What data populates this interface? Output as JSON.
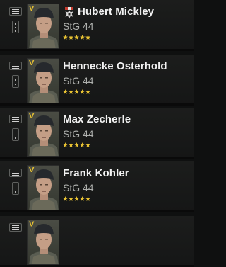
{
  "soldiers": [
    {
      "name": "Hubert Mickley",
      "weapon": "StG 44",
      "rank": "V",
      "stars": 5,
      "has_medal": true,
      "dots": 3
    },
    {
      "name": "Hennecke Osterhold",
      "weapon": "StG 44",
      "rank": "V",
      "stars": 5,
      "has_medal": false,
      "dots": 2
    },
    {
      "name": "Max Zecherle",
      "weapon": "StG 44",
      "rank": "V",
      "stars": 5,
      "has_medal": false,
      "dots": 1
    },
    {
      "name": "Frank Kohler",
      "weapon": "StG 44",
      "rank": "V",
      "stars": 5,
      "has_medal": false,
      "dots": 1
    },
    {
      "name": "",
      "weapon": "",
      "rank": "V",
      "stars": 0,
      "has_medal": false,
      "dots": 0
    }
  ],
  "colors": {
    "star": "#e8c233",
    "rank": "#e8c233",
    "background": "#151616"
  },
  "icons": {
    "list_button": "list-icon",
    "medal": "iron-cross-medal-icon",
    "star": "star-icon"
  }
}
